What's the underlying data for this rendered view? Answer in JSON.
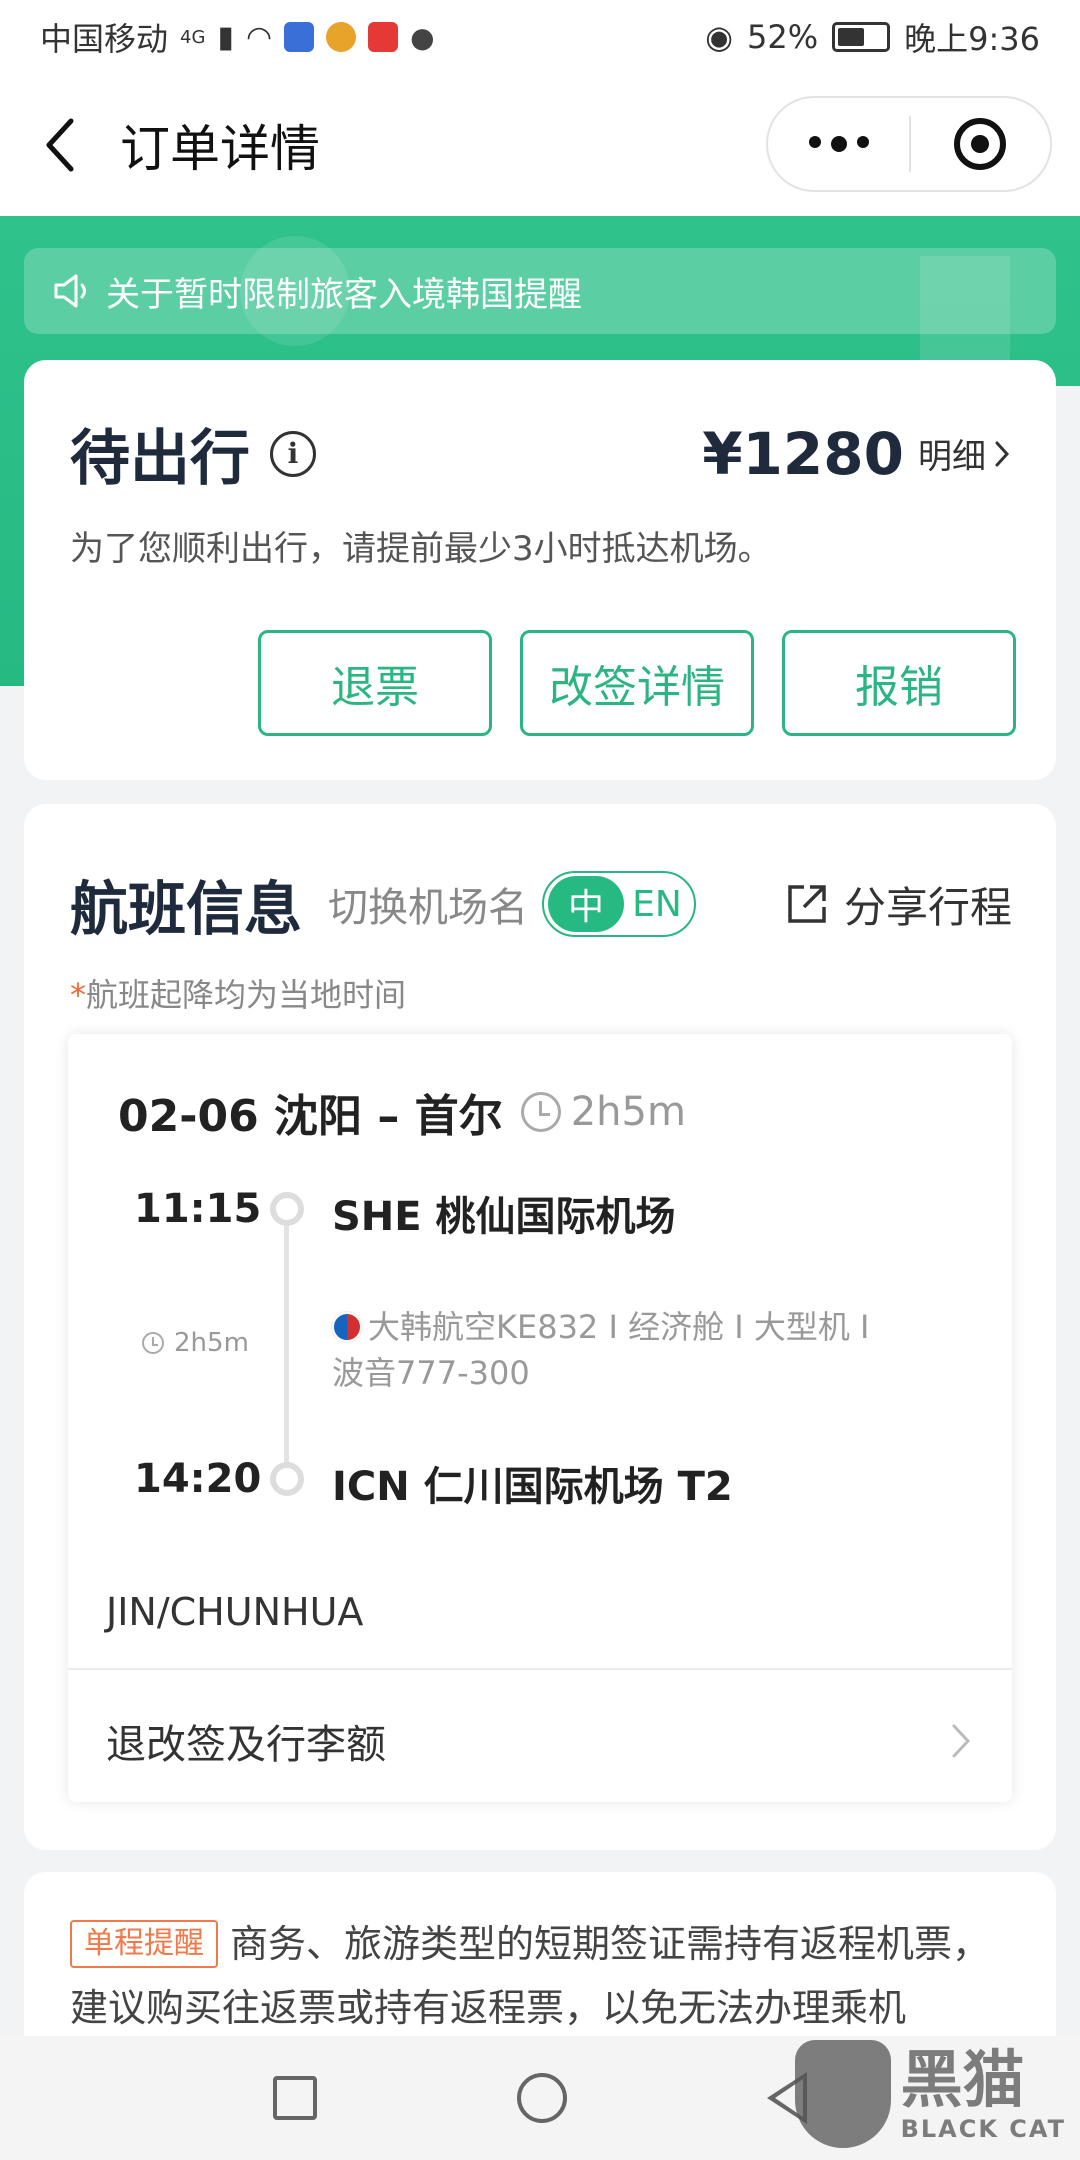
{
  "status_bar": {
    "carrier": "中国移动",
    "network": "4G",
    "battery": "52%",
    "time": "晚上9:36"
  },
  "nav": {
    "title": "订单详情"
  },
  "notice": {
    "text": "关于暂时限制旅客入境韩国提醒"
  },
  "order": {
    "status": "待出行",
    "price": "¥1280",
    "detail_label": "明细",
    "reminder": "为了您顺利出行，请提前最少3小时抵达机场。",
    "buttons": [
      "退票",
      "改签详情",
      "报销"
    ]
  },
  "flight_info": {
    "title": "航班信息",
    "switch_label": "切换机场名",
    "toggle_on": "中",
    "toggle_off": "EN",
    "share_label": "分享行程",
    "note_star": "*",
    "note": "航班起降均为当地时间",
    "date_route": "02-06 沈阳 – 首尔",
    "duration": "2h5m",
    "departure_time": "11:15",
    "departure_airport": "SHE 桃仙国际机场",
    "mid_duration": "2h5m",
    "airline_line1": "大韩航空KE832 I 经济舱 I 大型机 I",
    "airline_line2": "波音777-300",
    "arrival_time": "14:20",
    "arrival_airport": "ICN 仁川国际机场 T2",
    "passenger": "JIN/CHUNHUA",
    "baggage_label": "退改签及行李额"
  },
  "tip": {
    "badge": "单程提醒",
    "text": "商务、旅游类型的短期签证需持有返程机票，建议购买往返票或持有返程票，以免无法办理乘机"
  },
  "watermark": {
    "cn": "黑猫",
    "en": "BLACK CAT"
  },
  "colors": {
    "accent": "#27b982",
    "warning": "#f07a4a"
  }
}
